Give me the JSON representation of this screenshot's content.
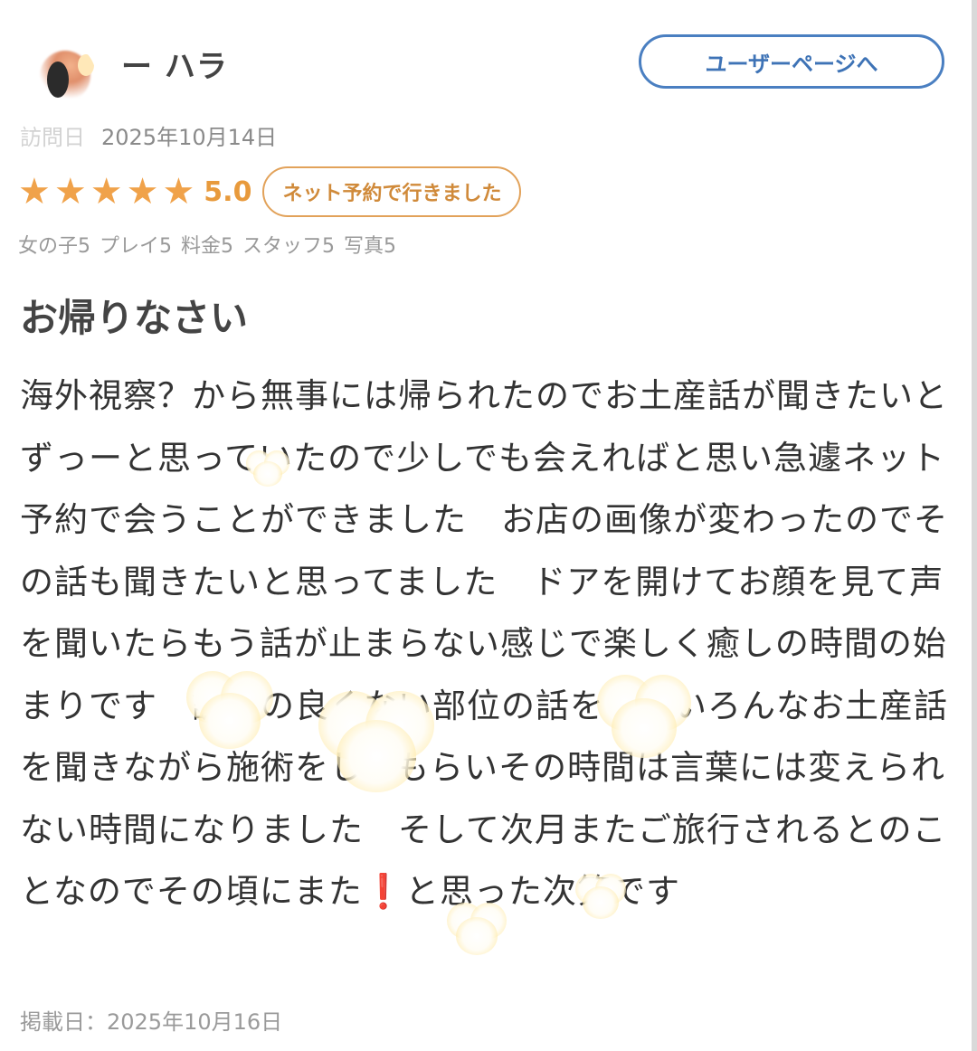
{
  "user": {
    "name": "ー ハラ",
    "page_button_label": "ユーザーページへ"
  },
  "visit": {
    "label": "訪問日",
    "date": "2025年10月14日"
  },
  "rating": {
    "stars": 5,
    "value": "5.0",
    "badge": "ネット予約で行きました"
  },
  "scores": [
    "女の子5",
    "プレイ5",
    "料金5",
    "スタッフ5",
    "写真5"
  ],
  "review": {
    "title": "お帰りなさい",
    "body_part1": "海外視察？から無事には帰られたのでお土産話が聞きたいとずっーと思っていたので少しでも会えればと思い急遽ネット予約で会うことができました　お店の画像が変わったのでその話も聞きたいと思ってました　ドアを開けてお顔を見て声を聞いたらもう話が止まらない感じで楽しく癒しの時間の始まりです　調子の良くない部位の話をし、いろんなお土産話を聞きながら施術をしてもらいその時間は言葉には変えられない時間になりました　そして次月またご旅行されるとのことなのでその頃にまた",
    "exclaim": "❗",
    "body_part2": "と思った次第です"
  },
  "posted": {
    "label": "掲載日：",
    "date": "2025年10月16日"
  },
  "colors": {
    "star": "#f0a24a",
    "accent_blue": "#4a7fc1",
    "badge_border": "#e2a25a"
  }
}
